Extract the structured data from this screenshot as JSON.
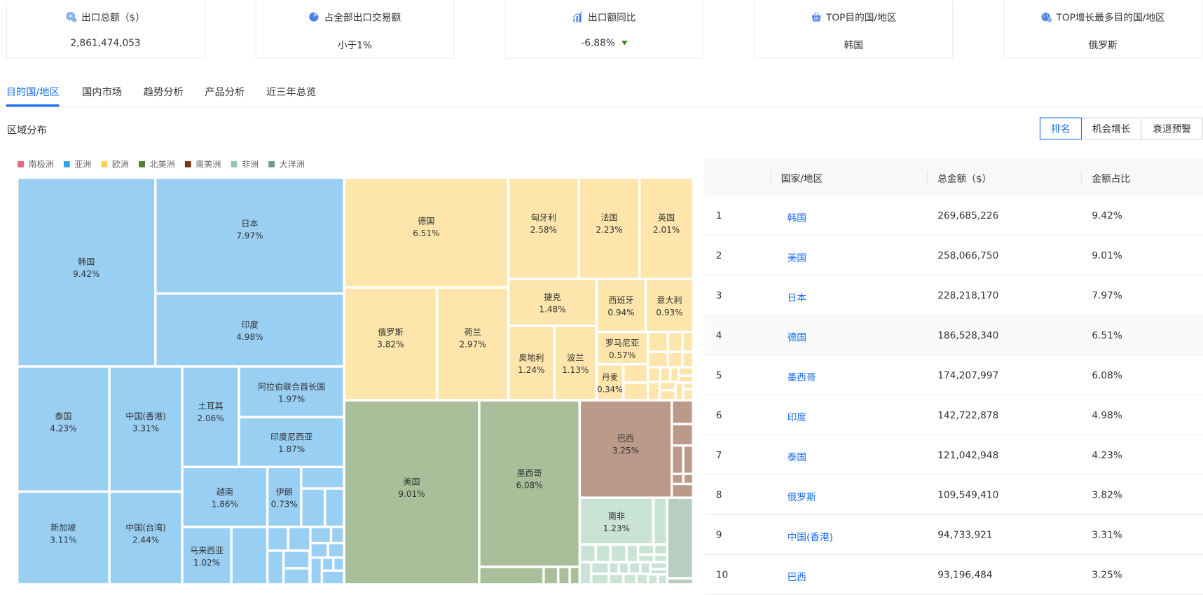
{
  "cards": [
    {
      "title": "出口总额（$）",
      "value": "2,861,474,053",
      "icon": "globe-dollar-icon"
    },
    {
      "title": "占全部出口交易额",
      "value": "小于1%",
      "icon": "pie-chart-icon"
    },
    {
      "title": "出口额同比",
      "value": "-6.88%",
      "icon": "bar-chart-icon",
      "trend": "down"
    },
    {
      "title": "TOP目的国/地区",
      "value": "韩国",
      "icon": "basket-icon"
    },
    {
      "title": "TOP增长最多目的国/地区",
      "value": "俄罗斯",
      "icon": "globe-growth-icon"
    }
  ],
  "tabs": [
    {
      "label": "目的国/地区",
      "active": true
    },
    {
      "label": "国内市场"
    },
    {
      "label": "趋势分析"
    },
    {
      "label": "产品分析"
    },
    {
      "label": "近三年总览"
    }
  ],
  "section_title": "区域分布",
  "view_buttons": [
    {
      "label": "排名",
      "active": true
    },
    {
      "label": "机会增长"
    },
    {
      "label": "衰退预警"
    }
  ],
  "colors": {
    "accent": "#1a6cf0",
    "trend_down": "#3f8a1a"
  },
  "chart_data": {
    "type": "treemap",
    "legend": [
      {
        "key": "antarctica",
        "label": "南极洲",
        "color": "#f0637f"
      },
      {
        "key": "asia",
        "label": "亚洲",
        "color": "#33a1e8"
      },
      {
        "key": "europe",
        "label": "欧洲",
        "color": "#fccf5b"
      },
      {
        "key": "north_america",
        "label": "北美洲",
        "color": "#4f7f2f"
      },
      {
        "key": "south_america",
        "label": "南美洲",
        "color": "#7b3418"
      },
      {
        "key": "africa",
        "label": "非洲",
        "color": "#8ec8ad"
      },
      {
        "key": "oceania",
        "label": "大洋洲",
        "color": "#6d9e80"
      }
    ],
    "fill_colors": {
      "asia": "#9acff4",
      "europe": "#fde5ab",
      "north_america": "#a9bf99",
      "south_america": "#bc9a89",
      "africa": "#c9e3d7",
      "oceania": "#b7cfc0"
    },
    "items": [
      {
        "name": "韩国",
        "pct": "9.42%",
        "continent": "asia"
      },
      {
        "name": "日本",
        "pct": "7.97%",
        "continent": "asia"
      },
      {
        "name": "印度",
        "pct": "4.98%",
        "continent": "asia"
      },
      {
        "name": "泰国",
        "pct": "4.23%",
        "continent": "asia"
      },
      {
        "name": "新加坡",
        "pct": "3.11%",
        "continent": "asia"
      },
      {
        "name": "中国(香港)",
        "pct": "3.31%",
        "continent": "asia"
      },
      {
        "name": "中国(台湾)",
        "pct": "2.44%",
        "continent": "asia"
      },
      {
        "name": "土耳其",
        "pct": "2.06%",
        "continent": "asia"
      },
      {
        "name": "阿拉伯联合酋长国",
        "pct": "1.97%",
        "continent": "asia"
      },
      {
        "name": "印度尼西亚",
        "pct": "1.87%",
        "continent": "asia"
      },
      {
        "name": "越南",
        "pct": "1.86%",
        "continent": "asia"
      },
      {
        "name": "马来西亚",
        "pct": "1.02%",
        "continent": "asia"
      },
      {
        "name": "伊朗",
        "pct": "0.73%",
        "continent": "asia"
      },
      {
        "name": "德国",
        "pct": "6.51%",
        "continent": "europe"
      },
      {
        "name": "俄罗斯",
        "pct": "3.82%",
        "continent": "europe"
      },
      {
        "name": "荷兰",
        "pct": "2.97%",
        "continent": "europe"
      },
      {
        "name": "匈牙利",
        "pct": "2.58%",
        "continent": "europe"
      },
      {
        "name": "法国",
        "pct": "2.23%",
        "continent": "europe"
      },
      {
        "name": "英国",
        "pct": "2.01%",
        "continent": "europe"
      },
      {
        "name": "捷克",
        "pct": "1.48%",
        "continent": "europe"
      },
      {
        "name": "奥地利",
        "pct": "1.24%",
        "continent": "europe"
      },
      {
        "name": "波兰",
        "pct": "1.13%",
        "continent": "europe"
      },
      {
        "name": "西班牙",
        "pct": "0.94%",
        "continent": "europe"
      },
      {
        "name": "意大利",
        "pct": "0.93%",
        "continent": "europe"
      },
      {
        "name": "罗马尼亚",
        "pct": "0.57%",
        "continent": "europe"
      },
      {
        "name": "丹麦",
        "pct": "0.34%",
        "continent": "europe"
      },
      {
        "name": "美国",
        "pct": "9.01%",
        "continent": "north_america"
      },
      {
        "name": "墨西哥",
        "pct": "6.08%",
        "continent": "north_america"
      },
      {
        "name": "巴西",
        "pct": "3.25%",
        "continent": "south_america"
      },
      {
        "name": "南非",
        "pct": "1.23%",
        "continent": "africa"
      }
    ]
  },
  "table": {
    "headers": [
      "",
      "国家/地区",
      "总金额（$）",
      "金额占比"
    ],
    "rows": [
      {
        "rank": "1",
        "country": "韩国",
        "total": "269,685,226",
        "ratio": "9.42%"
      },
      {
        "rank": "2",
        "country": "美国",
        "total": "258,066,750",
        "ratio": "9.01%"
      },
      {
        "rank": "3",
        "country": "日本",
        "total": "228,218,170",
        "ratio": "7.97%"
      },
      {
        "rank": "4",
        "country": "德国",
        "total": "186,528,340",
        "ratio": "6.51%"
      },
      {
        "rank": "5",
        "country": "墨西哥",
        "total": "174,207,997",
        "ratio": "6.08%"
      },
      {
        "rank": "6",
        "country": "印度",
        "total": "142,722,878",
        "ratio": "4.98%"
      },
      {
        "rank": "7",
        "country": "泰国",
        "total": "121,042,948",
        "ratio": "4.23%"
      },
      {
        "rank": "8",
        "country": "俄罗斯",
        "total": "109,549,410",
        "ratio": "3.82%"
      },
      {
        "rank": "9",
        "country": "中国(香港)",
        "total": "94,733,921",
        "ratio": "3.31%"
      },
      {
        "rank": "10",
        "country": "巴西",
        "total": "93,196,484",
        "ratio": "3.25%"
      }
    ]
  }
}
